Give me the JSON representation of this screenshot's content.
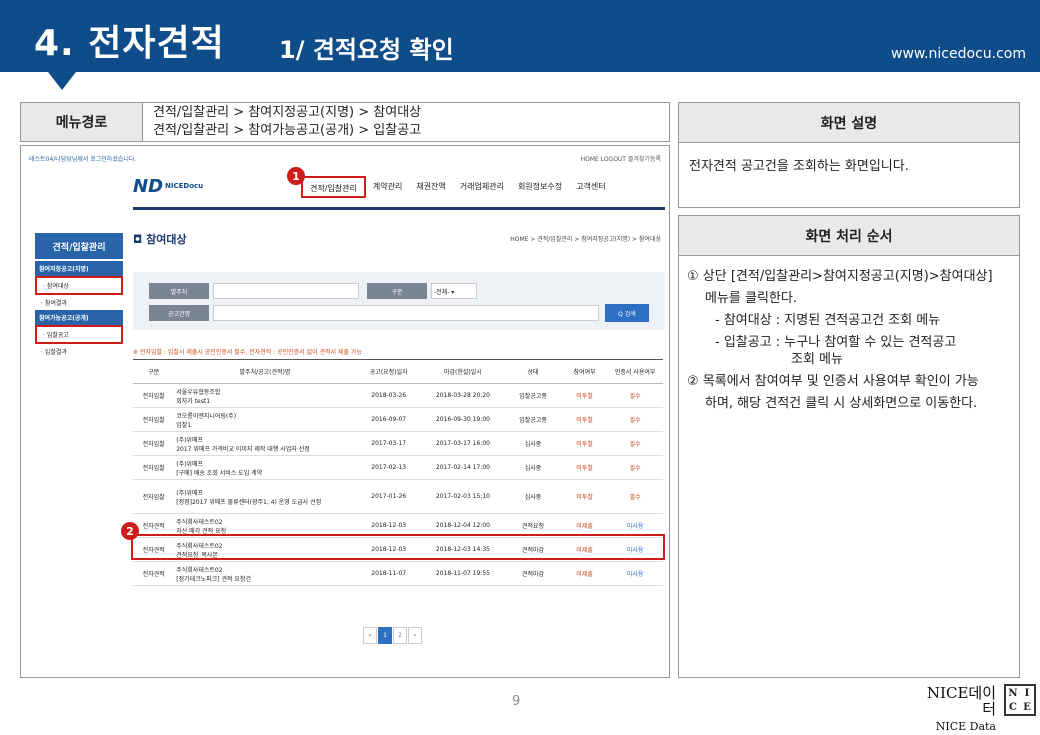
{
  "header": {
    "title": "4. 전자견적",
    "subtitle": "1/ 견적요청 확인",
    "url": "www.nicedocu.com"
  },
  "menu": {
    "label": "메뉴경로",
    "paths": [
      "견적/입찰관리 > 참여지정공고(지명) > 참여대상",
      "견적/입찰관리 > 참여가능공고(공개) > 입찰공고"
    ]
  },
  "description": {
    "heading": "화면 설명",
    "text": "전자견적 공고건을 조회하는 화면입니다."
  },
  "process": {
    "heading": "화면 처리 순서",
    "lines": [
      "① 상단 [견적/입찰관리>참여지정공고(지명)>참여대상]",
      "메뉴를 클릭한다.",
      "- 참여대상 : 지명된 견적공고건 조회 메뉴",
      "- 입찰공고 : 누구나 참여할 수 있는 견적공고",
      "조회 메뉴",
      "② 목록에서 참여여부 및 인증서 사용여부 확인이 가능",
      "하며, 해당 견적건 클릭 시 상세화면으로 이동한다."
    ]
  },
  "screen": {
    "top_left": "테스트04/나담당님께서 로그인하셨습니다.",
    "top_right": "HOME   LOGOUT   즐겨찾기등록",
    "logo": {
      "mark": "ND",
      "name": "NICEDocu"
    },
    "nav": [
      "견적/입찰관리",
      "계약관리",
      "채권잔액",
      "거래업체관리",
      "회원정보수정",
      "고객센터"
    ],
    "sidebar": {
      "title": "견적/입찰관리",
      "groups": [
        {
          "label": "참여지정공고(지명)",
          "items": [
            "· 참여대상",
            "· 참여결과"
          ]
        },
        {
          "label": "참여가능공고(공개)",
          "items": [
            "· 입찰공고",
            "· 입찰결과"
          ]
        }
      ]
    },
    "page_title": "참여대상",
    "breadcrumb": "HOME > 견적/입찰관리 > 참여지정공고(지명) > 참여대상",
    "search": {
      "orderer_label": "발주처",
      "type_label": "구분",
      "type_value": "-전체-  ▾",
      "name_label": "공고건명",
      "button": "Q 검색"
    },
    "notice": "※ 전자입찰 : 입찰시 제출시 공인인증서 필수, 전자견적 : 공인인증서 없이 견적서 제출 가능",
    "table": {
      "headers": [
        "구분",
        "발주처/공고(견적)명",
        "공고(요청)일자",
        "마감(현설)일시",
        "상태",
        "참여여부",
        "인증서 사용여부"
      ],
      "rows": [
        {
          "type": "전자입찰",
          "name": "서울우유협동조합\n회자가 test1",
          "date": "2018-03-26",
          "deadline": "2018-03-28 20:20",
          "status": "입찰공고중",
          "join": "미투찰",
          "cert": "필수"
        },
        {
          "type": "전자입찰",
          "name": "코오롱이엔지니어링(주)\n입찰1",
          "date": "2016-09-07",
          "deadline": "2016-09-30 19:00",
          "status": "입찰공고중",
          "join": "미투찰",
          "cert": "필수"
        },
        {
          "type": "전자입찰",
          "name": "(주)위메프\n2017 위메프 가격비교 이미지 제작 대행 사업자 선정",
          "date": "2017-03-17",
          "deadline": "2017-03-17 16:00",
          "status": "심사중",
          "join": "미투찰",
          "cert": "필수"
        },
        {
          "type": "전자입찰",
          "name": "(주)위메프\n[구매] 배송 조회 서비스 도입 계약",
          "date": "2017-02-13",
          "deadline": "2017-02-14 17:00",
          "status": "심사중",
          "join": "미투찰",
          "cert": "필수"
        },
        {
          "type": "전자입찰",
          "name": "(주)위메프\n[정정]2017 위메프 물류센터(광주1, 4) 운영 도급사 선정",
          "date": "2017-01-26",
          "deadline": "2017-02-03 15:10",
          "status": "심사중",
          "join": "미투찰",
          "cert": "필수"
        },
        {
          "type": "전자견적",
          "name": "주식회사테스트02\n자산 매각 견적 요청",
          "date": "2018-12-03",
          "deadline": "2018-12-04 12:00",
          "status": "견적요청",
          "join": "미제출",
          "cert": "미사용"
        },
        {
          "type": "전자견적",
          "name": "주식회사테스트02\n견적요청_복사본",
          "date": "2018-12-03",
          "deadline": "2018-12-03 14:35",
          "status": "견적마감",
          "join": "미제출",
          "cert": "미사용"
        },
        {
          "type": "전자견적",
          "name": "주식회사테스트02\n[정기테크노파크] 견적 요청건",
          "date": "2018-11-07",
          "deadline": "2018-11-07 19:55",
          "status": "견적마감",
          "join": "미제출",
          "cert": "미사용"
        }
      ]
    },
    "pager": [
      "«",
      "1",
      "2",
      "»"
    ],
    "badges": [
      "1",
      "2"
    ]
  },
  "footer": {
    "page": "9",
    "brand_ko": "NICE데이터",
    "brand_en": "NICE Data",
    "box_letters": [
      "N",
      "I",
      "C",
      "E"
    ]
  }
}
